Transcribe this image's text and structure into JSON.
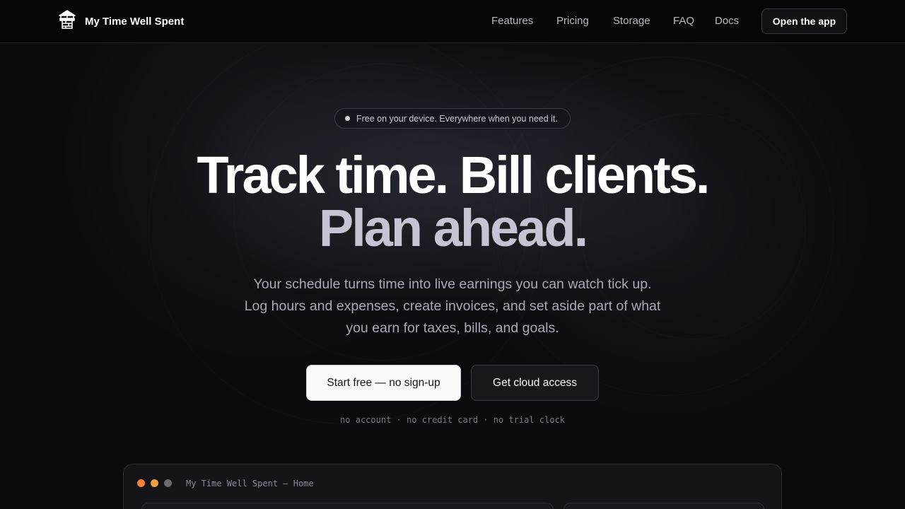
{
  "nav": {
    "brand": "My Time Well Spent",
    "brand_icon": "wishing-well-icon",
    "links": [
      "Features",
      "Pricing",
      "Storage",
      "FAQ",
      "Docs"
    ],
    "cta": "Open the app"
  },
  "hero": {
    "pill": "Free on your device. Everywhere when you need it.",
    "headline_line1": "Track time. Bill clients.",
    "headline_line2": "Plan ahead.",
    "subtitle_lines": [
      "Your schedule turns time into live earnings you can watch tick up.",
      "Log hours and expenses, create invoices, and set aside part of what",
      "you earn for taxes, bills, and goals."
    ],
    "primary_button": "Start free — no sign-up",
    "secondary_button": "Get cloud access",
    "note": "no account · no credit card · no trial clock"
  },
  "preview": {
    "window_title": "My Time Well Spent — Home",
    "dot_colors": [
      "#f0803a",
      "#f0a040",
      "#6b6b70"
    ]
  },
  "colors": {
    "background": "#0b0b0f",
    "headline_secondary": "#c4c4d2",
    "primary_button_bg": "#fafafa"
  }
}
